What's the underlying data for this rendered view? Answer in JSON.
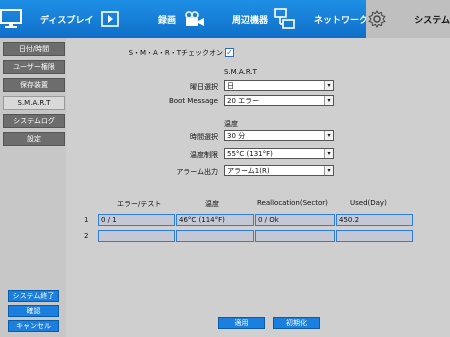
{
  "nav": {
    "tabs": [
      {
        "label": "ディスプレイ",
        "icon": "monitor-icon"
      },
      {
        "label": "録画",
        "icon": "camera-icon"
      },
      {
        "label": "周辺機器",
        "icon": "devices-icon"
      },
      {
        "label": "ネットワーク",
        "icon": "network-icon"
      },
      {
        "label": "システム",
        "icon": "gear-icon"
      }
    ],
    "active_tab": "システム"
  },
  "sidebar": {
    "items": [
      "日付/時間",
      "ユーザー権限",
      "保存装置",
      "S.M.A.R.T",
      "システムログ",
      "設定"
    ],
    "active_item": "S.M.A.R.T",
    "bottom_buttons": [
      "システム終了",
      "確認",
      "キャンセル"
    ]
  },
  "form": {
    "smart_check_label": "S・M・A・R・Tチェックオン",
    "smart_check_checked": true,
    "smart_section_title": "S.M.A.R.T",
    "day_select_label": "曜日選択",
    "day_select_value": "日",
    "boot_message_label": "Boot Message",
    "boot_message_value": "20 エラー",
    "temp_section_title": "温度",
    "time_select_label": "時間選択",
    "time_select_value": "30 分",
    "temp_limit_label": "温度制限",
    "temp_limit_value": "55°C (131°F)",
    "alarm_output_label": "アラーム出力",
    "alarm_output_value": "アラーム1(R)"
  },
  "table": {
    "headers": [
      "エラー/テスト",
      "温度",
      "Reallocation(Sector)",
      "Used(Day)"
    ],
    "rows": [
      {
        "num": "1",
        "cells": [
          "0 / 1",
          "46°C (114°F)",
          "0 / Ok",
          "450.2"
        ]
      },
      {
        "num": "2",
        "cells": [
          "",
          "",
          "",
          ""
        ]
      }
    ]
  },
  "footer": {
    "apply_label": "適用",
    "reset_label": "初期化"
  },
  "colors": {
    "accent": "#1a7fdf",
    "topbar": "#1577d4",
    "panel": "#cfcfcf",
    "background": "#8f8f8f"
  }
}
